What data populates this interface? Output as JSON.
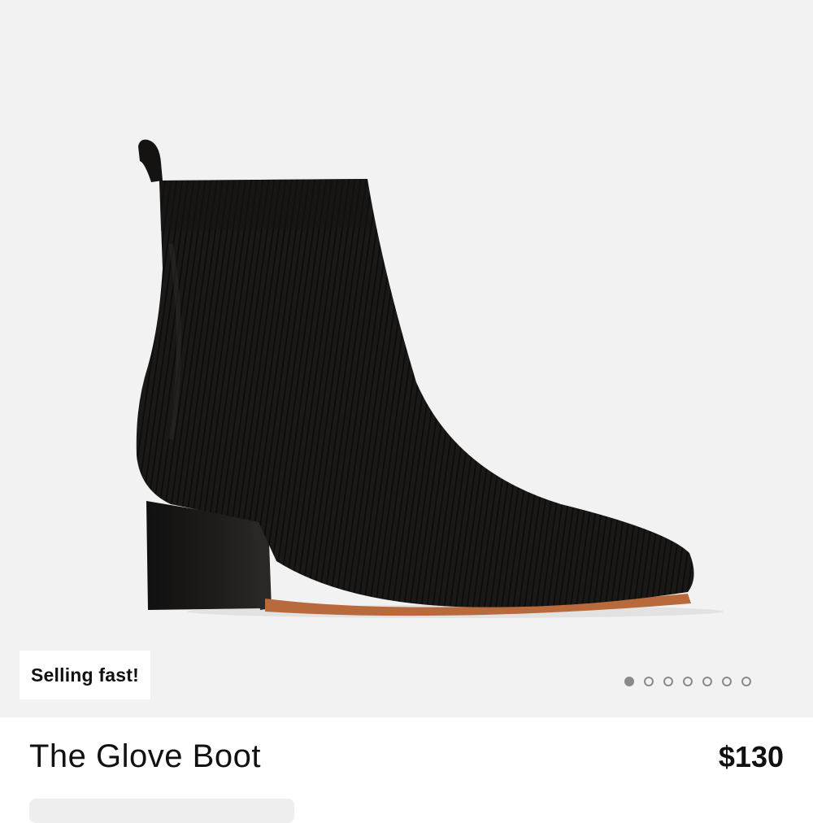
{
  "product": {
    "badge": "Selling fast!",
    "name": "The Glove Boot",
    "price": "$130"
  },
  "gallery": {
    "image_count": 7,
    "active_index": 0
  },
  "colors": {
    "hero_background": "#f2f2f2",
    "boot_knit": "#1a1816",
    "heel_wood": "#151311",
    "sole_leather": "#b86a3c"
  }
}
